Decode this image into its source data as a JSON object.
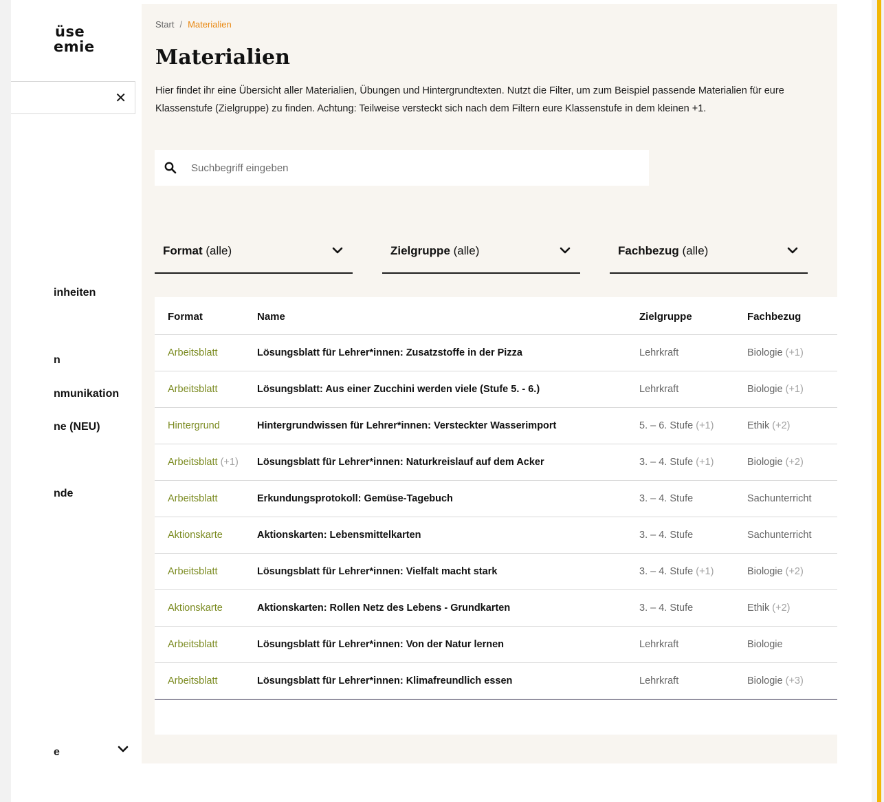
{
  "sidebar": {
    "logo_line1": "üse",
    "logo_line2": "emie",
    "close_symbol": "✕",
    "items": [
      {
        "label": "inheiten"
      },
      {
        "label": "n"
      },
      {
        "label": "nmunikation"
      },
      {
        "label": "ne (NEU)"
      },
      {
        "label": "nde"
      }
    ],
    "bottom_label": "e",
    "bottom_icon": "chevron-down-icon"
  },
  "breadcrumb": {
    "home": "Start",
    "separator": "/",
    "current": "Materialien"
  },
  "page": {
    "title": "Materialien",
    "intro": "Hier findet ihr eine Übersicht aller Materialien, Übungen und Hintergrundtexten. Nutzt die Filter, um zum Beispiel passende Materialien für eure Klassenstufe (Zielgruppe) zu finden. Achtung: Teilweise versteckt sich nach dem Filtern eure Klassenstufe in dem kleinen +1."
  },
  "search": {
    "placeholder": "Suchbegriff eingeben",
    "value": "",
    "icon": "search-icon"
  },
  "filters": [
    {
      "name": "Format",
      "value": "(alle)"
    },
    {
      "name": "Zielgruppe",
      "value": "(alle)"
    },
    {
      "name": "Fachbezug",
      "value": "(alle)"
    }
  ],
  "table": {
    "headers": {
      "format": "Format",
      "name": "Name",
      "zielgruppe": "Zielgruppe",
      "fachbezug": "Fachbezug"
    },
    "rows": [
      {
        "format": "Arbeitsblatt",
        "format_plus": "",
        "name": "Lösungsblatt für Lehrer*innen: Zusatzstoffe in der Pizza",
        "ziel": "Lehrkraft",
        "ziel_plus": "",
        "fach": "Biologie",
        "fach_plus": "(+1)"
      },
      {
        "format": "Arbeitsblatt",
        "format_plus": "",
        "name": "Lösungsblatt: Aus einer Zucchini werden viele (Stufe 5. - 6.)",
        "ziel": "Lehrkraft",
        "ziel_plus": "",
        "fach": "Biologie",
        "fach_plus": "(+1)"
      },
      {
        "format": "Hintergrund",
        "format_plus": "",
        "name": "Hintergrundwissen für Lehrer*innen: Versteckter Wasserimport",
        "ziel": "5. – 6. Stufe",
        "ziel_plus": "(+1)",
        "fach": "Ethik",
        "fach_plus": "(+2)"
      },
      {
        "format": "Arbeitsblatt",
        "format_plus": "(+1)",
        "name": "Lösungsblatt für Lehrer*innen: Naturkreislauf auf dem Acker",
        "ziel": "3. – 4. Stufe",
        "ziel_plus": "(+1)",
        "fach": "Biologie",
        "fach_plus": "(+2)"
      },
      {
        "format": "Arbeitsblatt",
        "format_plus": "",
        "name": "Erkundungsprotokoll: Gemüse-Tagebuch",
        "ziel": "3. – 4. Stufe",
        "ziel_plus": "",
        "fach": "Sachunterricht",
        "fach_plus": ""
      },
      {
        "format": "Aktionskarte",
        "format_plus": "",
        "name": "Aktionskarten: Lebensmittelkarten",
        "ziel": "3. – 4. Stufe",
        "ziel_plus": "",
        "fach": "Sachunterricht",
        "fach_plus": ""
      },
      {
        "format": "Arbeitsblatt",
        "format_plus": "",
        "name": "Lösungsblatt für Lehrer*innen: Vielfalt macht stark",
        "ziel": "3. – 4. Stufe",
        "ziel_plus": "(+1)",
        "fach": "Biologie",
        "fach_plus": "(+2)"
      },
      {
        "format": "Aktionskarte",
        "format_plus": "",
        "name": "Aktionskarten: Rollen Netz des Lebens - Grundkarten",
        "ziel": "3. – 4. Stufe",
        "ziel_plus": "",
        "fach": "Ethik",
        "fach_plus": "(+2)"
      },
      {
        "format": "Arbeitsblatt",
        "format_plus": "",
        "name": "Lösungsblatt für Lehrer*innen: Von der Natur lernen",
        "ziel": "Lehrkraft",
        "ziel_plus": "",
        "fach": "Biologie",
        "fach_plus": ""
      },
      {
        "format": "Arbeitsblatt",
        "format_plus": "",
        "name": "Lösungsblatt für Lehrer*innen: Klimafreundlich essen",
        "ziel": "Lehrkraft",
        "ziel_plus": "",
        "fach": "Biologie",
        "fach_plus": "(+3)"
      }
    ]
  },
  "colors": {
    "accent_orange": "#e8870f",
    "format_green": "#7a8a1f",
    "panel_bg": "#f8f5f0",
    "side_stripe": "#f2b705"
  }
}
